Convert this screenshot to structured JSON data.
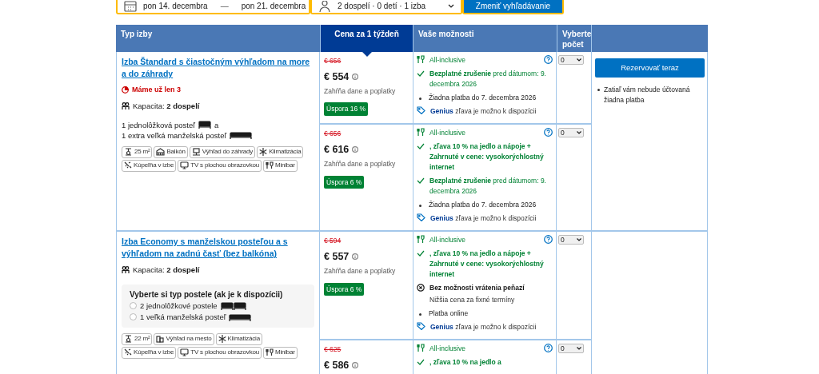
{
  "search_bar": {
    "dates": {
      "check_in": "pon 14. decembra",
      "separator": "—",
      "check_out": "pon 21. decembra"
    },
    "guests": "2 dospelí · 0 detí · 1 izba",
    "button": "Zmeniť vyhľadávanie"
  },
  "table": {
    "columns": [
      {
        "label": "Typ izby",
        "highlighted": false
      },
      {
        "label": "Cena za 1 týždeň",
        "highlighted": true
      },
      {
        "label": "Vaše možnosti",
        "highlighted": false
      },
      {
        "label": "Vyberte počet",
        "highlighted": false
      },
      {
        "highlighted": false
      }
    ],
    "rooms": [
      {
        "title": "Izba Štandard s čiastočným výhľadom na more a do záhrady",
        "scarcity": "Máme už len 3",
        "capacity": "Kapacita: **2 dospelí**",
        "beds": [
          {
            "text": "1 jednolôžková posteľ",
            "kind": "single",
            "suffix": "a"
          },
          {
            "text": "1 extra veľká manželská posteľ",
            "kind": "double"
          }
        ],
        "facilities": [
          {
            "kind": "size",
            "label": "25 m²"
          },
          {
            "kind": "balcony",
            "label": "Balkón"
          },
          {
            "kind": "view",
            "label": "Výhľad do záhrady"
          },
          {
            "kind": "ac",
            "label": "Klimatizácia"
          },
          {
            "kind": "bathroom",
            "label": "Kúpeľňa v izbe"
          },
          {
            "kind": "tv",
            "label": "TV s plochou obrazovkou"
          },
          {
            "kind": "minibar",
            "label": "Minibar"
          }
        ],
        "reserve": {
          "button": "Rezervovať teraz",
          "note": "Zatiaľ vám nebude účtovaná žiadna platba"
        },
        "offers": [
          {
            "old_price": "€ 656",
            "price": "€ 554",
            "taxes": "Zahŕňa dane a poplatky",
            "savings": "Úspora 16 %",
            "count": "0",
            "options": [
              {
                "kind": "meal",
                "text": "All-inclusive"
              },
              {
                "kind": "cancel",
                "text": "**Bezplatné zrušenie** pred dátumom: 9. decembra 2026"
              },
              {
                "kind": "payment",
                "text": "Žiadna platba do 7. decembra 2026"
              },
              {
                "kind": "genius",
                "text": "**Genius** zľava je možno k dispozícii"
              }
            ]
          },
          {
            "old_price": "€ 656",
            "price": "€ 616",
            "taxes": "Zahŕňa dane a poplatky",
            "savings": "Úspora 6 %",
            "count": "0",
            "options": [
              {
                "kind": "meal",
                "text": "All-inclusive"
              },
              {
                "kind": "perk",
                "text": ", zľava 10 % na jedlo a nápoje + Zahrnuté v cene: vysokorýchlostný internet"
              },
              {
                "kind": "cancel",
                "text": "**Bezplatné zrušenie** pred dátumom: 9. decembra 2026"
              },
              {
                "kind": "payment",
                "text": "Žiadna platba do 7. decembra 2026"
              },
              {
                "kind": "genius",
                "text": "**Genius** zľava je možno k dispozícii"
              }
            ]
          }
        ]
      },
      {
        "title": "Izba Economy s manželskou posteľou a s výhľadom na zadnú časť (bez balkóna)",
        "capacity": "Kapacita: **2 dospelí**",
        "bed_choice": {
          "title": "Vyberte si typ postele (ak je k dispozícii)",
          "options": [
            {
              "text": "2 jednolôžkové postele",
              "kind": "two_single",
              "selected": false
            },
            {
              "text": "1 veľká manželská posteľ",
              "kind": "double",
              "selected": false
            }
          ]
        },
        "facilities": [
          {
            "kind": "size",
            "label": "22 m²"
          },
          {
            "kind": "city",
            "label": "Výhľad na mesto"
          },
          {
            "kind": "ac",
            "label": "Klimatizácia"
          },
          {
            "kind": "bathroom",
            "label": "Kúpeľňa v izbe"
          },
          {
            "kind": "tv",
            "label": "TV s plochou obrazovkou"
          },
          {
            "kind": "minibar",
            "label": "Minibar"
          }
        ],
        "offers": [
          {
            "old_price": "€ 594",
            "price": "€ 557",
            "taxes": "Zahŕňa dane a poplatky",
            "savings": "Úspora 6 %",
            "count": "0",
            "options": [
              {
                "kind": "meal",
                "text": "All-inclusive"
              },
              {
                "kind": "perk",
                "text": ", zľava 10 % na jedlo a nápoje + Zahrnuté v cene: vysokorýchlostný internet"
              },
              {
                "kind": "nonrefundable",
                "text": "Bez možnosti vrátenia peňazí",
                "sub": "Nižšia cena za fixné termíny"
              },
              {
                "kind": "payment",
                "text": "Platba online"
              },
              {
                "kind": "genius",
                "text": "**Genius** zľava je možno k dispozícii"
              }
            ]
          },
          {
            "old_price": "€ 625",
            "price": "€ 586",
            "count": "0",
            "options": [
              {
                "kind": "meal",
                "text": "All-inclusive"
              },
              {
                "kind": "perk",
                "text": ", zľava 10 % na jedlo a"
              }
            ]
          }
        ]
      }
    ]
  }
}
